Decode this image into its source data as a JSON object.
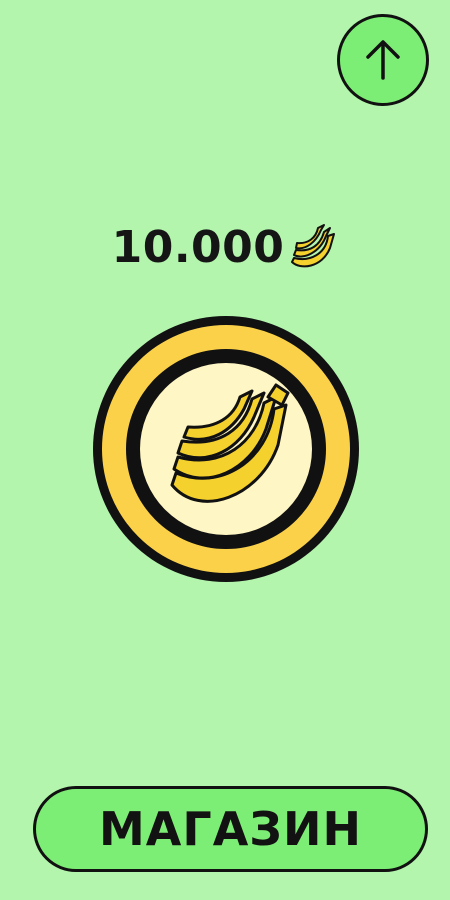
{
  "header": {
    "up_button_icon": "arrow-up-icon"
  },
  "balance": {
    "value": "10.000",
    "currency_icon": "banana-icon"
  },
  "tap_coin": {
    "icon": "banana-bunch-icon"
  },
  "shop_button": {
    "label": "МАГАЗИН"
  },
  "colors": {
    "background": "#b3f5ad",
    "button_fill": "#7dee75",
    "coin_outer": "#fcd14a",
    "coin_inner": "#fef6c4",
    "banana": "#f5d12e",
    "outline": "#111111"
  }
}
